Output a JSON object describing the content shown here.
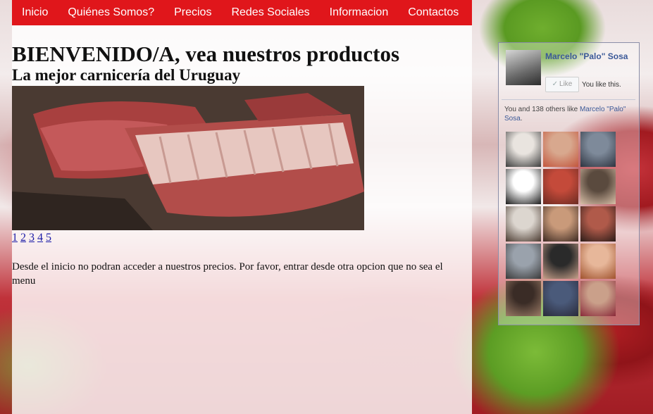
{
  "nav": {
    "items": [
      {
        "label": "Inicio"
      },
      {
        "label": "Quiénes Somos?"
      },
      {
        "label": "Precios"
      },
      {
        "label": "Redes Sociales"
      },
      {
        "label": "Informacion"
      },
      {
        "label": "Contactos"
      }
    ],
    "color": "#e0161b"
  },
  "main": {
    "title": "BIENVENIDO/A, vea nuestros productos",
    "subtitle": "La mejor carnicería del Uruguay",
    "slider_pages": [
      "1",
      "2",
      "3",
      "4",
      "5"
    ],
    "notice": "Desde el inicio no podran acceder a nuestros precios. Por favor, entrar desde otra opcion que no sea el menu"
  },
  "facebook": {
    "page_name": "Marcelo \"Palo\" Sosa",
    "like_label": "Like",
    "you_like": "You like this.",
    "social_prefix": "You and 138 others like",
    "social_link": "Marcelo \"Palo\" Sosa",
    "social_suffix": ".",
    "faces": [
      {
        "c1": "#e9e4df",
        "c2": "#3c3c3c"
      },
      {
        "c1": "#d8a88e",
        "c2": "#c3563d"
      },
      {
        "c1": "#7e8a9a",
        "c2": "#2e3440"
      },
      {
        "c1": "#ffffff",
        "c2": "#1b1b1b"
      },
      {
        "c1": "#c44a3a",
        "c2": "#6b2b22"
      },
      {
        "c1": "#5a4a3e",
        "c2": "#d9c0a8"
      },
      {
        "c1": "#dcd6cf",
        "c2": "#4a3a30"
      },
      {
        "c1": "#c99a7a",
        "c2": "#3c2a22"
      },
      {
        "c1": "#b05a4a",
        "c2": "#2a1c18"
      },
      {
        "c1": "#9aa2ac",
        "c2": "#3a3a3a"
      },
      {
        "c1": "#2a2a2a",
        "c2": "#c7a089"
      },
      {
        "c1": "#e7b79a",
        "c2": "#a0522d"
      },
      {
        "c1": "#3a2c26",
        "c2": "#9b7b66"
      },
      {
        "c1": "#4a5a7a",
        "c2": "#2a2a3a"
      },
      {
        "c1": "#caa08a",
        "c2": "#8a2a3a"
      }
    ]
  }
}
